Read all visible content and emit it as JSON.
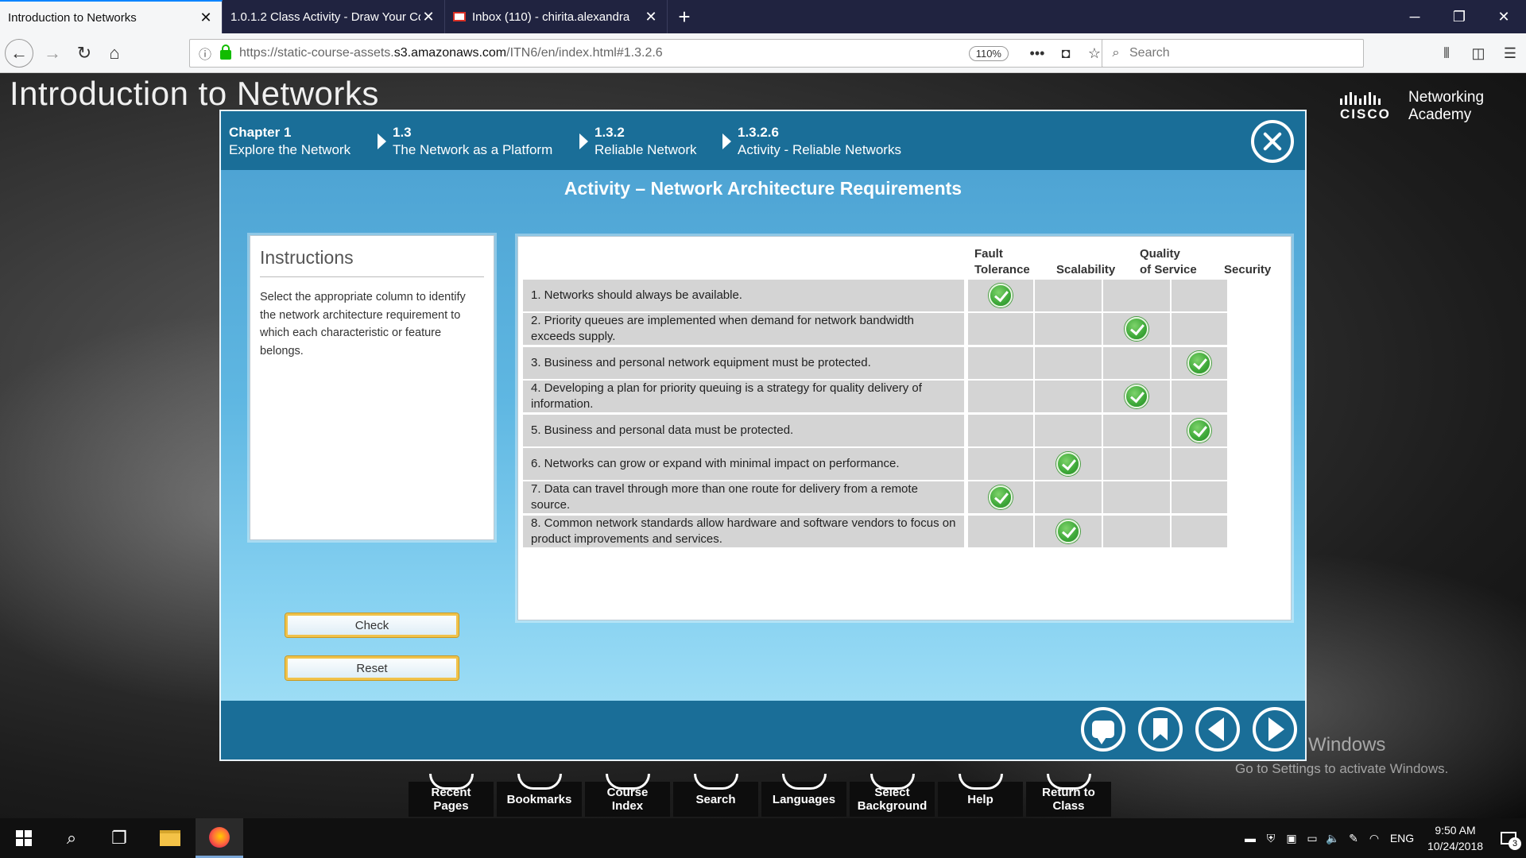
{
  "browser": {
    "tabs": [
      {
        "title": "Introduction to Networks",
        "active": true
      },
      {
        "title": "1.0.1.2 Class Activity - Draw Your Co",
        "active": false
      },
      {
        "title": "Inbox (110) - chirita.alexandra",
        "active": false
      }
    ],
    "url_prefix": "https://static-course-assets.",
    "url_host": "s3.amazonaws.com",
    "url_path": "/ITN6/en/index.html#1.3.2.6",
    "zoom": "110%",
    "search_placeholder": "Search"
  },
  "course": {
    "title": "Introduction to Networks",
    "logo_word": "CISCO",
    "logo_line1": "Networking",
    "logo_line2": "Academy"
  },
  "breadcrumb": [
    {
      "num": "Chapter 1",
      "label": "Explore the Network"
    },
    {
      "num": "1.3",
      "label": "The Network as a Platform"
    },
    {
      "num": "1.3.2",
      "label": "Reliable Network"
    },
    {
      "num": "1.3.2.6",
      "label": "Activity - Reliable Networks"
    }
  ],
  "activity": {
    "title": "Activity – Network Architecture Requirements",
    "instructions_heading": "Instructions",
    "instructions_text": "Select the appropriate column to identify the network architecture requirement to which each characteristic or feature belongs.",
    "check_label": "Check",
    "reset_label": "Reset",
    "columns": [
      {
        "line1": "Fault",
        "line2": "Tolerance"
      },
      {
        "line1": "",
        "line2": "Scalability"
      },
      {
        "line1": "Quality",
        "line2": "of Service"
      },
      {
        "line1": "",
        "line2": "Security"
      }
    ],
    "rows": [
      {
        "text": "1. Networks should always be available.",
        "selected": 0
      },
      {
        "text": "2. Priority queues are implemented when demand for network bandwidth exceeds supply.",
        "selected": 2
      },
      {
        "text": "3. Business and personal network equipment must be protected.",
        "selected": 3
      },
      {
        "text": "4. Developing a plan for priority queuing is a strategy for quality delivery of information.",
        "selected": 2
      },
      {
        "text": "5. Business and personal data must be protected.",
        "selected": 3
      },
      {
        "text": "6. Networks can grow or expand with minimal impact on performance.",
        "selected": 1
      },
      {
        "text": "7. Data can travel through more than one route for delivery from a remote source.",
        "selected": 0
      },
      {
        "text": "8. Common network standards allow hardware and software vendors to focus on product improvements and services.",
        "selected": 1
      }
    ]
  },
  "course_nav": [
    {
      "line1": "Recent",
      "line2": "Pages"
    },
    {
      "line1": "Bookmarks",
      "line2": ""
    },
    {
      "line1": "Course",
      "line2": "Index"
    },
    {
      "line1": "Search",
      "line2": ""
    },
    {
      "line1": "Languages",
      "line2": ""
    },
    {
      "line1": "Select",
      "line2": "Background"
    },
    {
      "line1": "Help",
      "line2": ""
    },
    {
      "line1": "Return to",
      "line2": "Class"
    }
  ],
  "watermark": {
    "line1": "Activate Windows",
    "line2": "Go to Settings to activate Windows."
  },
  "taskbar": {
    "lang": "ENG",
    "time": "9:50 AM",
    "date": "10/24/2018",
    "notifications": "3"
  }
}
